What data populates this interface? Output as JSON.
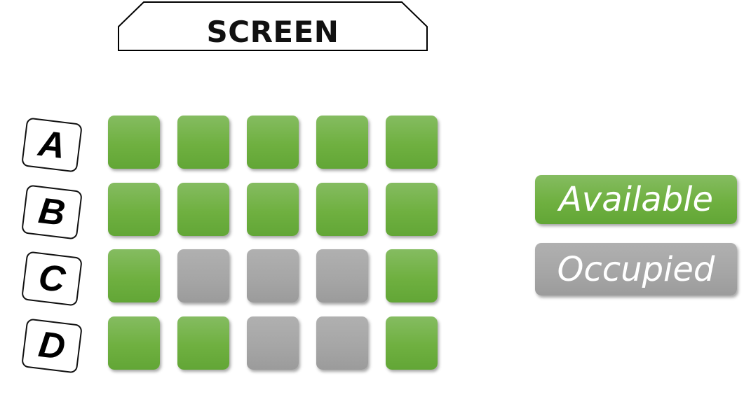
{
  "screen": {
    "label": "SCREEN"
  },
  "rows": [
    {
      "label": "A",
      "seats": [
        "available",
        "available",
        "available",
        "available",
        "available"
      ]
    },
    {
      "label": "B",
      "seats": [
        "available",
        "available",
        "available",
        "available",
        "available"
      ]
    },
    {
      "label": "C",
      "seats": [
        "available",
        "occupied",
        "occupied",
        "occupied",
        "available"
      ]
    },
    {
      "label": "D",
      "seats": [
        "available",
        "available",
        "occupied",
        "occupied",
        "available"
      ]
    }
  ],
  "legend": {
    "available": "Available",
    "occupied": "Occupied"
  },
  "colors": {
    "available": "#70ad47",
    "occupied": "#a5a5a5"
  }
}
